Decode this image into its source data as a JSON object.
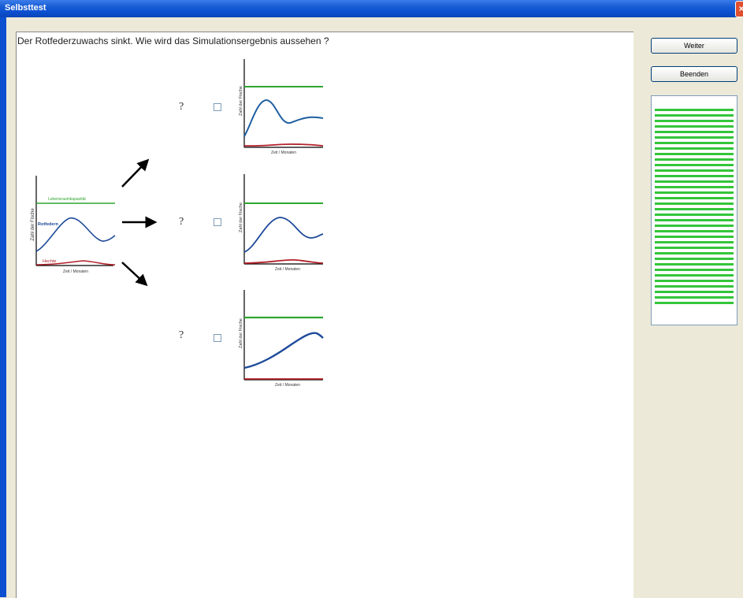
{
  "window": {
    "title": "Selbsttest"
  },
  "question": "Der Rotfederzuwachs sinkt. Wie wird das Simulationsergebnis aussehen ?",
  "buttons": {
    "next": "Weiter",
    "quit": "Beenden"
  },
  "source_chart": {
    "ylabel": "Zahl der Fische",
    "xlabel": "Zeit / Monaten",
    "capacity_label": "Lebensraumkapazität",
    "prey_label": "Rotfedern",
    "predator_label": "Hechte"
  },
  "options": [
    {
      "mark": "?",
      "ylabel": "Zahl der Fische",
      "xlabel": "Zeit / Monaten"
    },
    {
      "mark": "?",
      "ylabel": "Zahl der Fische",
      "xlabel": "Zeit / Monaten"
    },
    {
      "mark": "?",
      "ylabel": "Zahl der Fische",
      "xlabel": "Zeit / Monaten"
    }
  ],
  "colors": {
    "capacity": "#2fa52f",
    "prey": "#1e4a9a",
    "predator": "#b3202a",
    "progress": "#34c53a",
    "titlebar": "#0c4fd0"
  },
  "progress": {
    "segments": 36
  }
}
